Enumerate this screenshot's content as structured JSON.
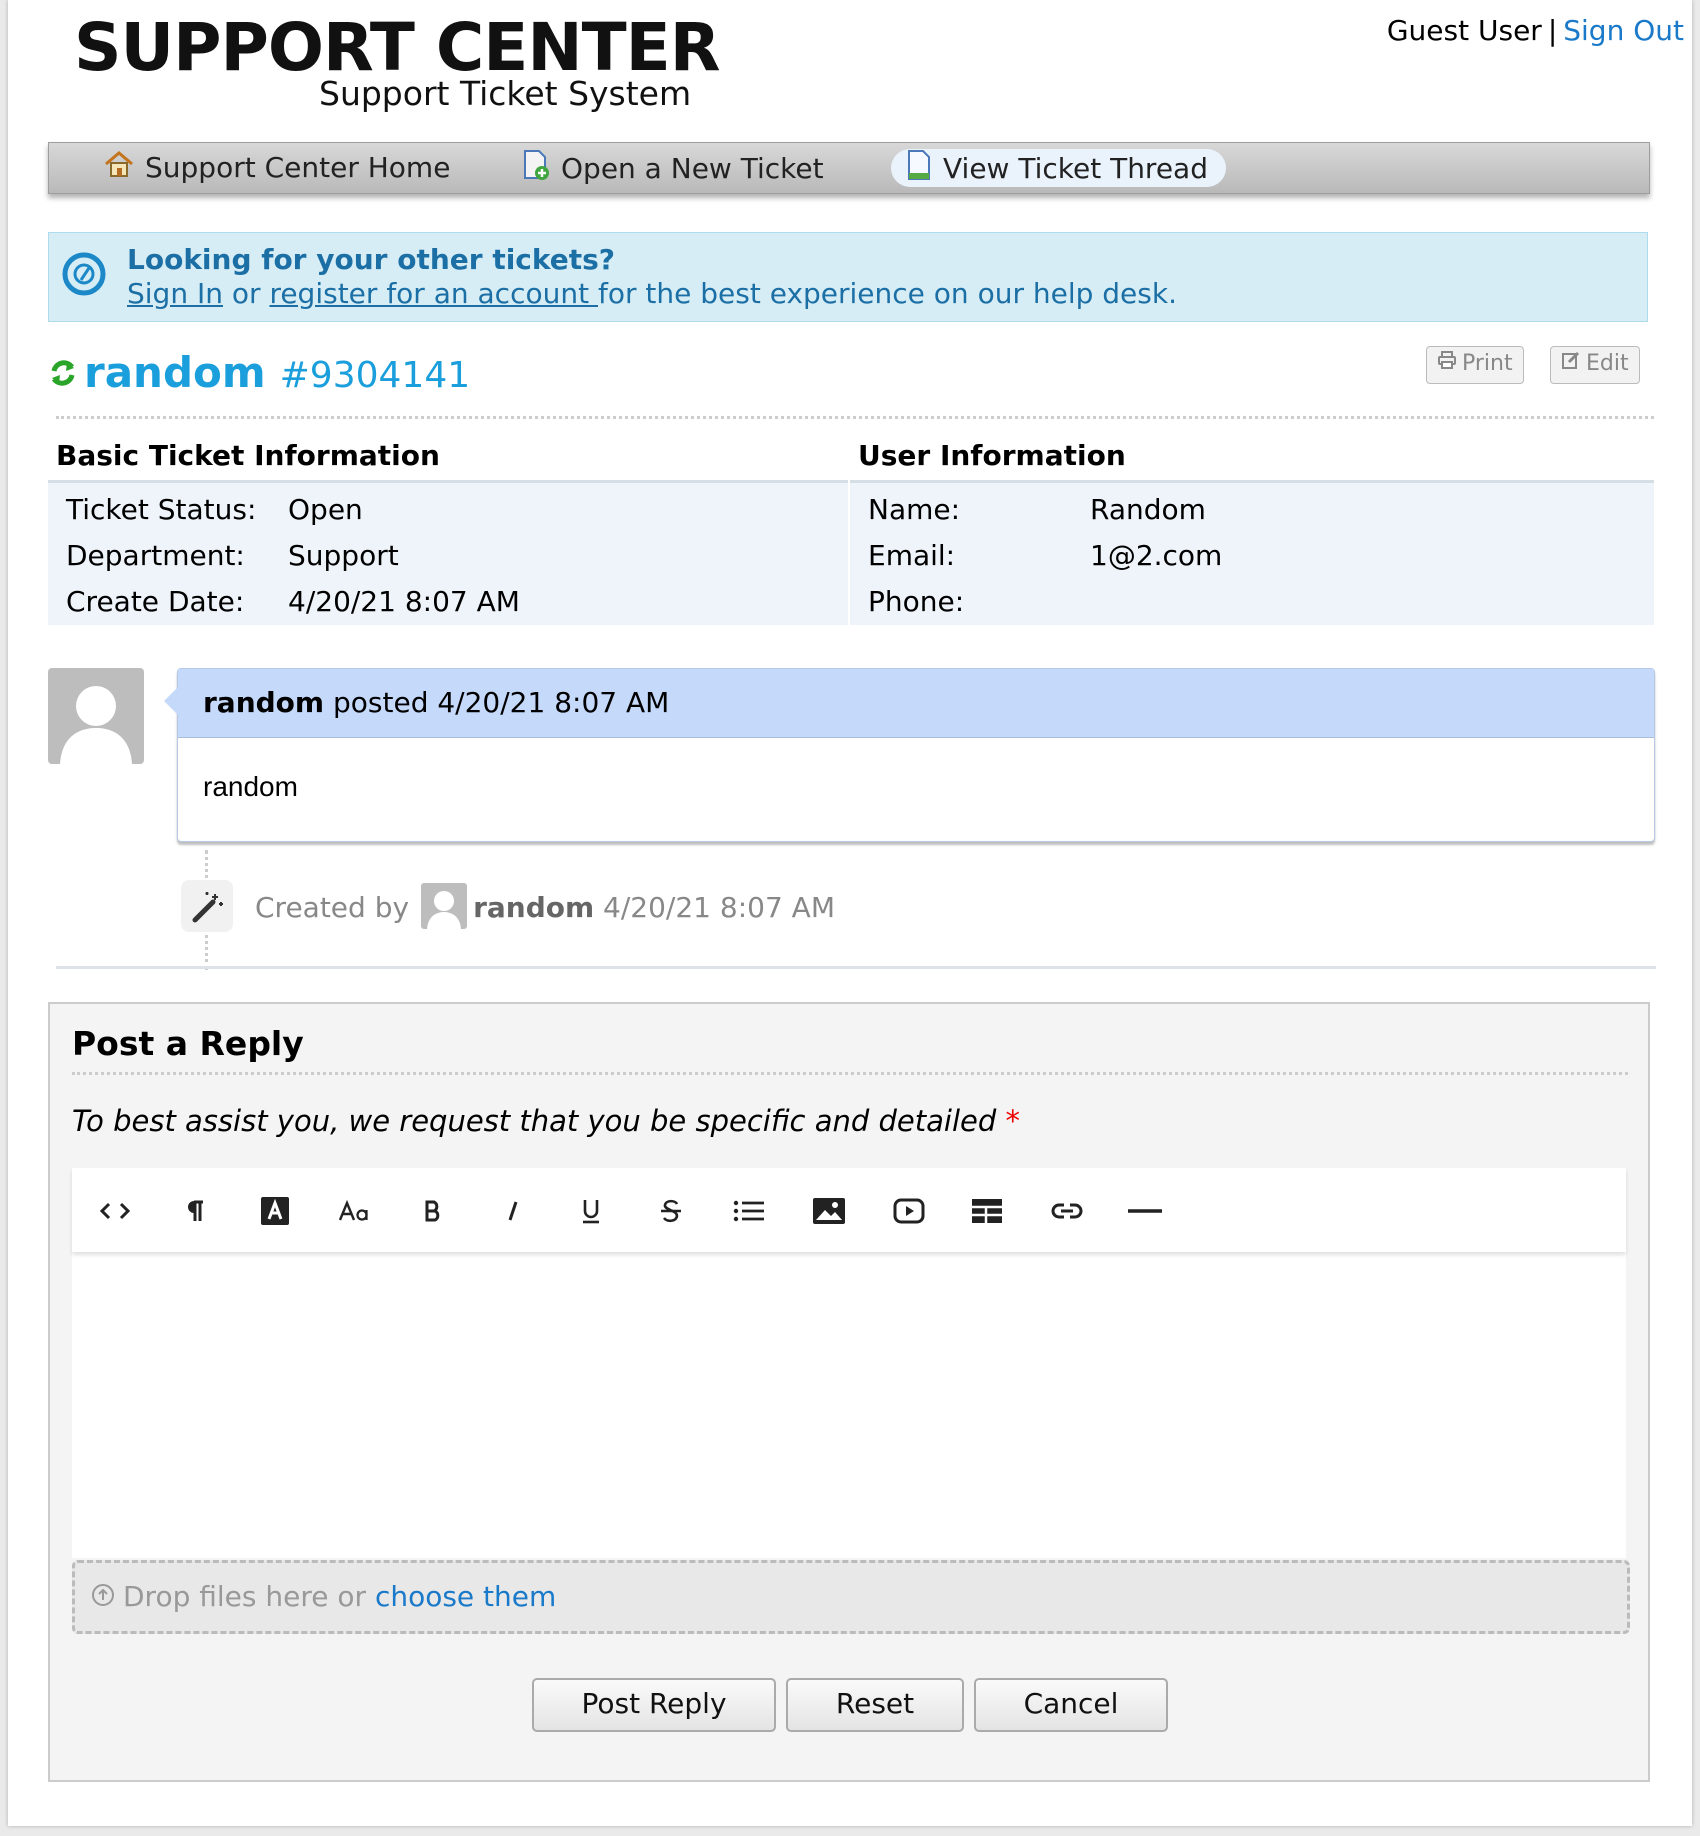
{
  "header": {
    "logo_title": "SUPPORT CENTER",
    "logo_subtitle": "Support Ticket System",
    "user_name": "Guest User",
    "separator": "|",
    "sign_out": "Sign Out"
  },
  "nav": {
    "items": [
      {
        "label": "Support Center Home",
        "icon": "home-icon",
        "active": false
      },
      {
        "label": "Open a New Ticket",
        "icon": "new-ticket-icon",
        "active": false
      },
      {
        "label": "View Ticket Thread",
        "icon": "ticket-thread-icon",
        "active": true
      }
    ]
  },
  "banner": {
    "title": "Looking for your other tickets?",
    "sign_in": "Sign In",
    "or": " or ",
    "register": "register for an account ",
    "rest": "for the best experience on our help desk."
  },
  "ticket": {
    "subject": "random",
    "number": "#9304141",
    "print_label": "Print",
    "edit_label": "Edit"
  },
  "basic_info": {
    "heading": "Basic Ticket Information",
    "rows": [
      {
        "label": "Ticket Status:",
        "value": "Open"
      },
      {
        "label": "Department:",
        "value": "Support"
      },
      {
        "label": "Create Date:",
        "value": "4/20/21 8:07 AM"
      }
    ]
  },
  "user_info": {
    "heading": "User Information",
    "rows": [
      {
        "label": "Name:",
        "value": "Random"
      },
      {
        "label": "Email:",
        "value": "1@2.com"
      },
      {
        "label": "Phone:",
        "value": ""
      }
    ]
  },
  "thread": {
    "message": {
      "author": "random",
      "posted": " posted 4/20/21 8:07 AM",
      "body": "random"
    },
    "event": {
      "created_by": "Created by",
      "user": "random",
      "time": " 4/20/21 8:07 AM"
    }
  },
  "reply": {
    "title": "Post a Reply",
    "instruction": "To best assist you, we request that you be specific and detailed",
    "required_mark": "*",
    "toolbar": [
      "code-view",
      "paragraph-format",
      "font-color",
      "font-size",
      "bold",
      "italic",
      "underline",
      "strikethrough",
      "bullet-list",
      "insert-image",
      "insert-video",
      "insert-table",
      "insert-link",
      "horizontal-rule"
    ],
    "dropzone_text": "Drop files here or ",
    "dropzone_link": "choose them",
    "buttons": {
      "post": "Post Reply",
      "reset": "Reset",
      "cancel": "Cancel"
    }
  },
  "colors": {
    "accent": "#1a9fdc",
    "link": "#1a7ac9",
    "banner_bg": "#d6edf6",
    "message_header_bg": "#c5d9fb",
    "status_icon": "#2aa52a"
  }
}
